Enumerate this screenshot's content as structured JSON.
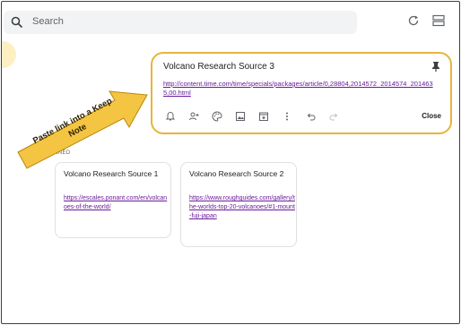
{
  "search": {
    "placeholder": "Search"
  },
  "header": {
    "refresh_icon": "refresh-icon",
    "layout_icon": "list-view-icon"
  },
  "note": {
    "title": "Volcano Research Source 3",
    "link": "http://content.time.com/time/specials/packages/article/0,28804,2014572_2014574_2014635,00.html",
    "close_label": "Close",
    "toolbar_icons": [
      "remind-icon",
      "collaborator-icon",
      "palette-icon",
      "image-icon",
      "archive-icon",
      "more-icon",
      "undo-icon",
      "redo-icon"
    ]
  },
  "pinned": {
    "label": "INNED"
  },
  "cards": [
    {
      "title": "Volcano Research Source 1",
      "link": "https://escales.ponant.com/en/volcanoes-of-the-world/"
    },
    {
      "title": "Volcano Research Source 2",
      "link": "https://www.roughguides.com/gallery/the-worlds-top-20-volcanoes/#1-mount-fuji-japan"
    }
  ],
  "annotation": {
    "text": "Paste link into a Keep Note",
    "color": "#f4c542",
    "border": "#b8860b"
  },
  "colors": {
    "note_border": "#e8b43a",
    "link": "#6a1b9a"
  }
}
